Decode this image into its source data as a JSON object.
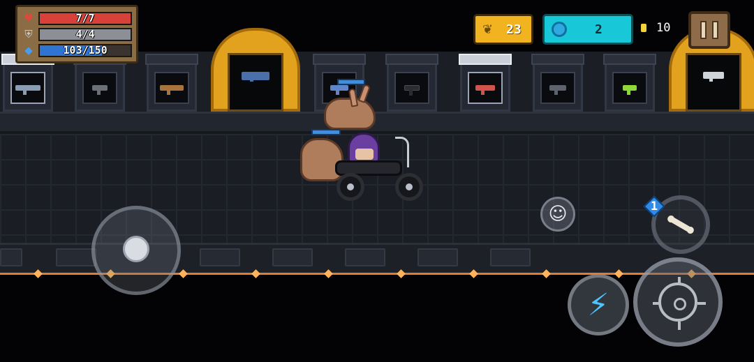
{
  "hud": {
    "health": {
      "icon": "heart-icon",
      "text": "7/7",
      "current": 7,
      "max": 7,
      "color": "#d8413a"
    },
    "armor": {
      "icon": "shield-icon",
      "text": "4/4",
      "current": 4,
      "max": 4,
      "color": "#8c8f95"
    },
    "energy": {
      "icon": "energy-crystal-icon",
      "text": "103/150",
      "current": 103,
      "max": 150,
      "color": "#2f74d0"
    },
    "materials": {
      "icon": "feather-icon",
      "value": "23",
      "color": "#f2b320"
    },
    "gems": {
      "icon": "gem-icon",
      "value": "2",
      "color": "#18c7d8"
    },
    "coins": {
      "icon": "coin-icon",
      "value": "10"
    },
    "pause": {
      "icon": "pause-icon"
    }
  },
  "weapons": [
    {
      "icon": "assault-rifle-icon",
      "color": "#8a9bb4",
      "display": "lit-case"
    },
    {
      "icon": "smg-icon",
      "color": "#6a6f78",
      "display": "case"
    },
    {
      "icon": "ak-rifle-icon",
      "color": "#a8743c",
      "display": "case"
    },
    {
      "icon": "heavy-cannon-icon",
      "color": "#4b6fa8",
      "display": "golden-arch"
    },
    {
      "icon": "blaster-icon",
      "color": "#5f86c8",
      "display": "case"
    },
    {
      "icon": "pistol-icon",
      "color": "#2a2c31",
      "display": "case"
    },
    {
      "icon": "ray-gun-icon",
      "color": "#d0544a",
      "display": "lit-case"
    },
    {
      "icon": "revolver-icon",
      "color": "#5d636d",
      "display": "case"
    },
    {
      "icon": "laser-pistol-icon",
      "color": "#8fd63a",
      "display": "case"
    },
    {
      "icon": "rocket-launcher-icon",
      "color": "#cfd3da",
      "display": "golden-arch"
    }
  ],
  "controls": {
    "joystick": {
      "icon": "joystick-icon"
    },
    "emote": {
      "icon": "smiley-face-icon"
    },
    "weapon_swap": {
      "icon": "bone-weapon-icon",
      "badge": "1"
    },
    "skill": {
      "icon": "lightning-bolt-icon"
    },
    "fire": {
      "icon": "crosshair-icon"
    }
  }
}
